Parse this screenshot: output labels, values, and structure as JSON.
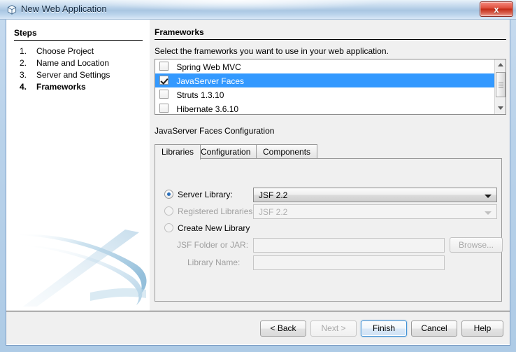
{
  "window": {
    "title": "New Web Application",
    "icon": "cube-icon",
    "close_label": "x"
  },
  "steps": {
    "heading": "Steps",
    "items": [
      {
        "num": "1.",
        "label": "Choose Project",
        "current": false
      },
      {
        "num": "2.",
        "label": "Name and Location",
        "current": false
      },
      {
        "num": "3.",
        "label": "Server and Settings",
        "current": false
      },
      {
        "num": "4.",
        "label": "Frameworks",
        "current": true
      }
    ]
  },
  "content": {
    "heading": "Frameworks",
    "description": "Select the frameworks you want to use in your web application.",
    "frameworks": [
      {
        "label": "Spring Web MVC",
        "checked": false,
        "selected": false
      },
      {
        "label": "JavaServer Faces",
        "checked": true,
        "selected": true
      },
      {
        "label": "Struts 1.3.10",
        "checked": false,
        "selected": false
      },
      {
        "label": "Hibernate 3.6.10",
        "checked": false,
        "selected": false
      }
    ],
    "config_label": "JavaServer Faces Configuration",
    "tabs": [
      {
        "label": "Libraries",
        "active": true
      },
      {
        "label": "Configuration",
        "active": false
      },
      {
        "label": "Components",
        "active": false
      }
    ],
    "libraries": {
      "server_library": {
        "label": "Server Library:",
        "selected": true,
        "value": "JSF 2.2"
      },
      "registered_libraries": {
        "label": "Registered Libraries:",
        "selected": false,
        "value": "JSF 2.2"
      },
      "create_new_library": {
        "label": "Create New Library",
        "selected": false
      },
      "jsf_folder": {
        "label": "JSF Folder or JAR:",
        "value": ""
      },
      "library_name": {
        "label": "Library Name:",
        "value": ""
      },
      "browse_label": "Browse..."
    }
  },
  "buttons": {
    "back": "< Back",
    "next": "Next >",
    "finish": "Finish",
    "cancel": "Cancel",
    "help": "Help"
  },
  "colors": {
    "selection_blue": "#3399ff",
    "accent_border": "#3c8fd4",
    "panel_bg": "#f0f0f0",
    "close_red": "#c22b18"
  }
}
